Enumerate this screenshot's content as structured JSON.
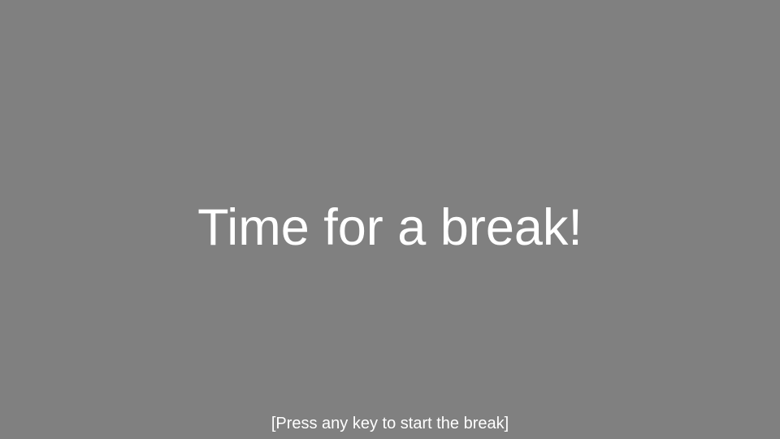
{
  "screen": {
    "background_color": "#808080",
    "text_color": "#ffffff",
    "headline": "Time for a break!",
    "instruction": "[Press any key to start the break]"
  }
}
